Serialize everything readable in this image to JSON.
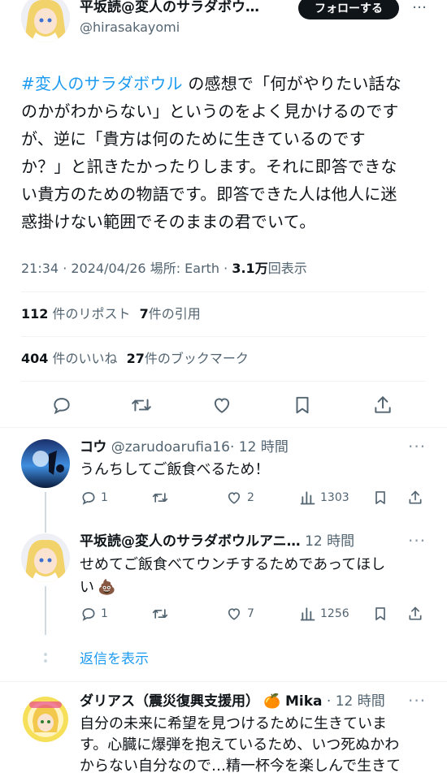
{
  "tweet": {
    "author_name": "平坂読@変人のサラダボウ…",
    "author_handle": "@hirasakayomi",
    "follow_label": "フォローする",
    "more_label": "…",
    "hashtag": "#変人のサラダボウル",
    "lines": [
      " の感想で「何がやりたい話な",
      "のかがわからない」というのをよく見かけるのです",
      "が、逆に「貴方は何のために生きているのです",
      "か？」と訊きたかったりします。それに即答できな",
      "い貴方のための物語です。即答できた人は他人に迷",
      "惑掛けない範囲でそのままの君でいて。"
    ],
    "time": "21:34 · 2024/04/26",
    "location": "場所: Earth ·",
    "views_count": "3.1万",
    "views_label": "回表示",
    "reposts_count": "112",
    "reposts_label": "件のリポスト",
    "quotes_count": "7",
    "quotes_label": "件の引用",
    "likes_count": "404",
    "likes_label": "件のいいね",
    "bookmarks_count": "27",
    "bookmarks_label": "件のブックマーク"
  },
  "replies": [
    {
      "name": "コウ",
      "handle": "@zarudoarufia16",
      "time": "· 12 時間",
      "text": "うんちしてご飯食べるため！",
      "reply_count": "1",
      "repost_count": "",
      "like_count": "2",
      "view_count": "1303"
    },
    {
      "name": "平坂読@変人のサラダボウルアニ…",
      "handle": "",
      "time": "12 時間",
      "text_line1": "せめてご飯食べてウンチするためであってほし",
      "text_line2": "い",
      "emoji": "💩",
      "reply_count": "1",
      "repost_count": "",
      "like_count": "7",
      "view_count": "1256"
    }
  ],
  "show_replies_label": "返信を表示",
  "third_reply": {
    "name": "ダリアス（震災復興支援用）",
    "emoji": "🍊",
    "name_suffix": "Mika",
    "time": "· 12 時間",
    "lines": [
      "自分の未来に希望を見つけるために生きていま",
      "す。心臓に爆弾を抱えているため、いつ死ぬかわ",
      "からない自分なので…精一杯今を楽しんで生きて"
    ]
  },
  "colors": {
    "accent": "#1d9bf0",
    "text": "#0f1419",
    "muted": "#536471",
    "follow_bg": "#0f1419"
  },
  "icons": [
    "reply-icon",
    "repost-icon",
    "like-icon",
    "bookmark-icon",
    "share-icon",
    "views-icon",
    "more-icon"
  ]
}
